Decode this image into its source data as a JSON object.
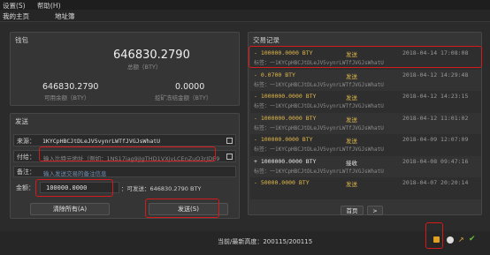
{
  "menu": {
    "settings": "设置(S)",
    "help": "帮助(H)"
  },
  "tabs": {
    "home": "我的主页",
    "addressbook": "地址簿"
  },
  "wallet": {
    "title": "钱包",
    "balance": "646830.2790",
    "balance_label": "总额（BTY）",
    "available": "646830.2790",
    "available_label": "可用余额（BTY）",
    "frozen": "0.0000",
    "frozen_label": "挖矿冻结金额（BTY）"
  },
  "send": {
    "title": "发送",
    "source_label": "来源：",
    "source_value": "1KYCpHBCJtDLeJV5vynrLWTfJVGJsWhatU",
    "pay_label": "付给：",
    "pay_placeholder": "输入比特元地址（例如：1NS17iag9jJgTHD1VXjvLCEnZuQ3rJDE9L）",
    "note_label": "备注：",
    "note_placeholder": "输入发送交易的备注信息",
    "amount_label": "金额：",
    "amount_value": "100000.0000",
    "sendable": "：可发送：646830.2790 BTY",
    "clear_button": "清除所有(A)",
    "send_button": "发送(S)"
  },
  "history": {
    "title": "交易记录",
    "items": [
      {
        "amount": "- 100000.0000 BTY",
        "type": "发送",
        "date": "2018-04-14 17:08:08",
        "label": "标签：一1KYCpHBCJtDLeJV5vynrLWTfJVGJsWhatU",
        "color": "#e0b84a"
      },
      {
        "amount": "- 0.0700 BTY",
        "type": "发送",
        "date": "2018-04-12 14:29:48",
        "label": "标签：一1KYCpHBCJtDLeJV5vynrLWTfJVGJsWhatU",
        "color": "#e0b84a"
      },
      {
        "amount": "- 1000000.0000 BTY",
        "type": "发送",
        "date": "2018-04-12 14:23:15",
        "label": "标签：一1KYCpHBCJtDLeJV5vynrLWTfJVGJsWhatU",
        "color": "#e0b84a"
      },
      {
        "amount": "- 1000000.0000 BTY",
        "type": "发送",
        "date": "2018-04-12 11:01:02",
        "label": "标签：一1KYCpHBCJtDLeJV5vynrLWTfJVGJsWhatU",
        "color": "#e0b84a"
      },
      {
        "amount": "- 100000.0000 BTY",
        "type": "发送",
        "date": "2018-04-09 12:07:09",
        "label": "标签：一1KYCpHBCJtDLeJV5vynrLWTfJVGJsWhatU",
        "color": "#e0b84a"
      },
      {
        "amount": "+ 1000000.0000 BTY",
        "type": "接收",
        "date": "2018-04-08 09:47:16",
        "label": "标签：一1KYCpHBCJtDLeJV5vynrLWTfJVGJsWhatU",
        "color": "#e6e6e6"
      },
      {
        "amount": "- 50000.0000 BTY",
        "type": "发送",
        "date": "2018-04-07 20:20:14",
        "label": "",
        "color": "#e0b84a"
      }
    ],
    "first_page": "首页",
    "next_page": ">"
  },
  "status": {
    "height": "当前/最新高度：200115/200115"
  }
}
